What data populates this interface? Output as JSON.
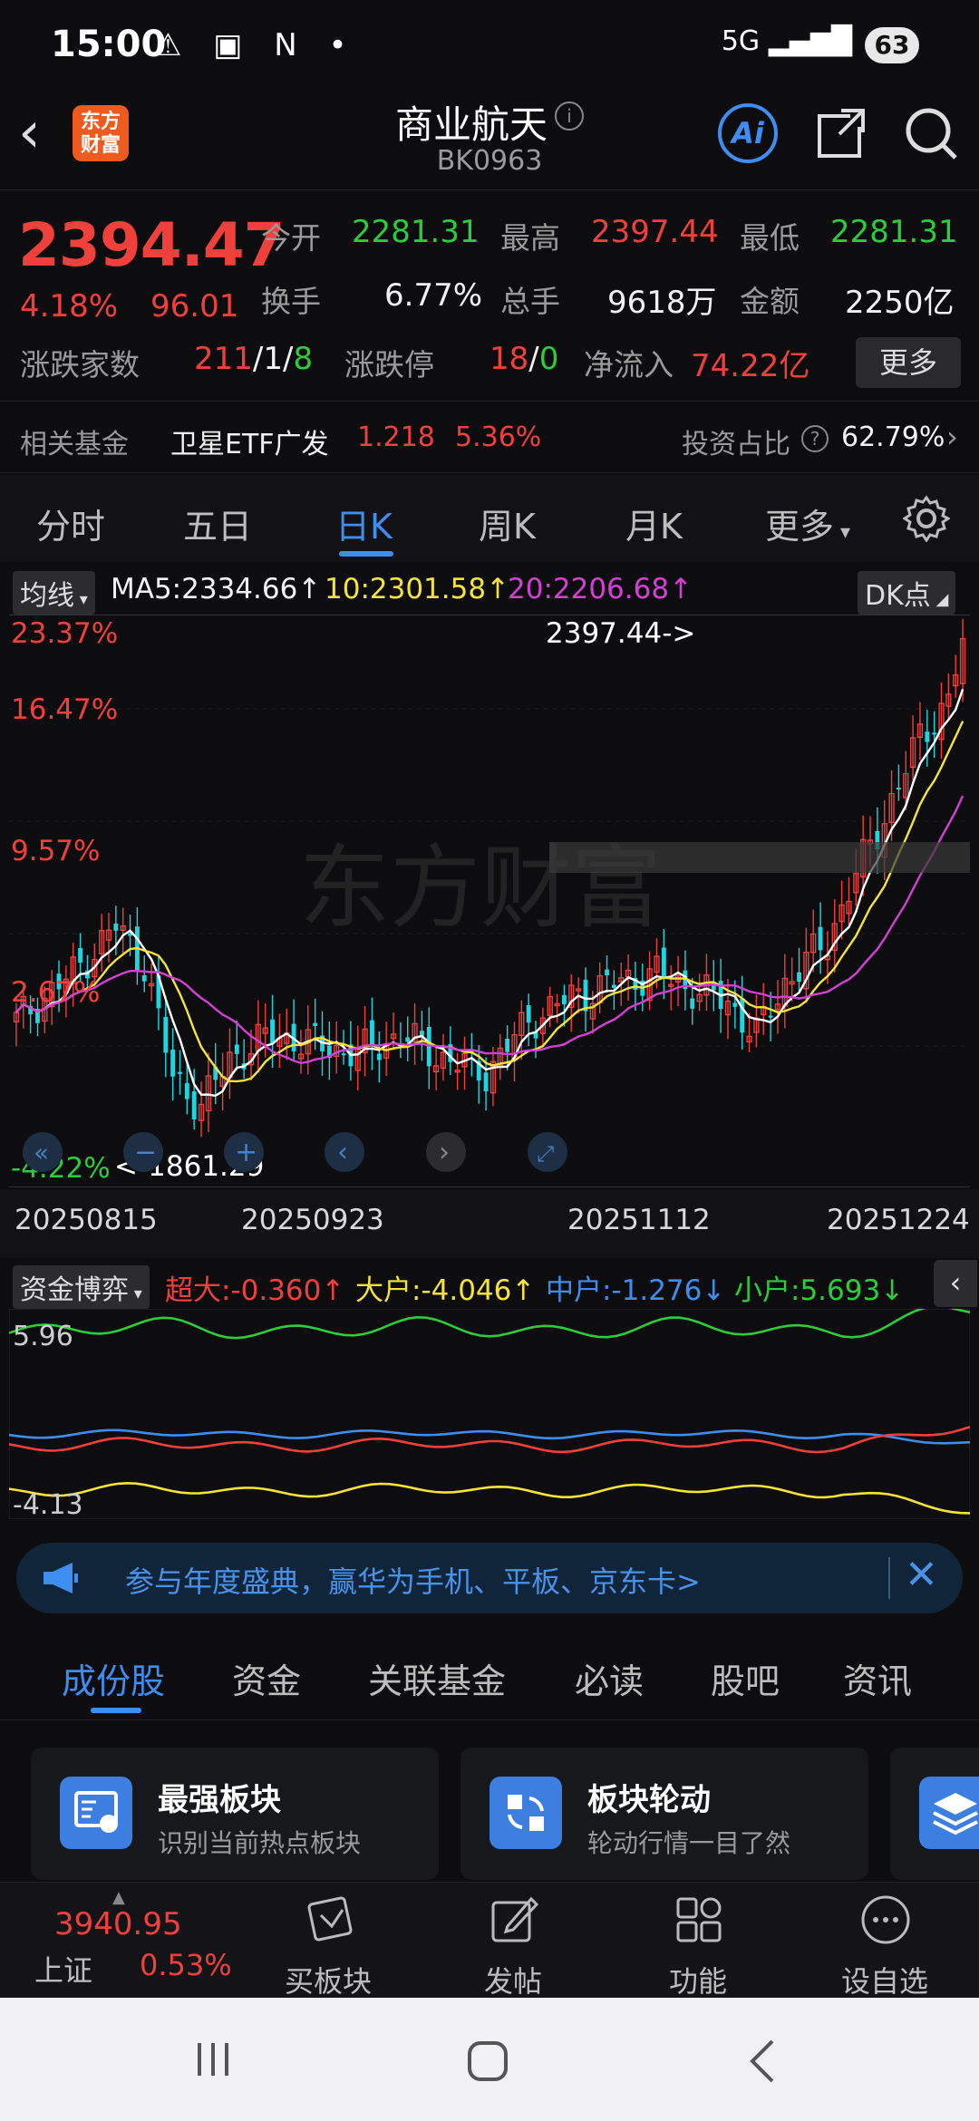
{
  "status": {
    "time": "15:00",
    "battery": "63",
    "signal": "5G"
  },
  "header": {
    "logo": "东方财富",
    "title": "商业航天",
    "code": "BK0963"
  },
  "quote": {
    "price": "2394.47",
    "pct": "4.18%",
    "change": "96.01",
    "rows": [
      [
        {
          "label": "今开",
          "value": "2281.31",
          "color": "green"
        },
        {
          "label": "最高",
          "value": "2397.44",
          "color": "red"
        },
        {
          "label": "最低",
          "value": "2281.31",
          "color": "green"
        }
      ],
      [
        {
          "label": "换手",
          "value": "6.77%",
          "color": "white"
        },
        {
          "label": "总手",
          "value": "9618万",
          "color": "white"
        },
        {
          "label": "金额",
          "value": "2250亿",
          "color": "white"
        }
      ]
    ],
    "breadth_label": "涨跌家数",
    "breadth_up": "211",
    "breadth_flat": "1",
    "breadth_down": "8",
    "limit_label": "涨跌停",
    "limit_up": "18",
    "limit_down": "0",
    "inflow_label": "净流入",
    "inflow": "74.22亿",
    "more": "更多"
  },
  "fund": {
    "label": "相关基金",
    "name": "卫星ETF广发",
    "price": "1.218",
    "pct": "5.36%",
    "ratio_label": "投资占比",
    "ratio": "62.79%"
  },
  "tabs": [
    "分时",
    "五日",
    "日K",
    "周K",
    "月K",
    "更多"
  ],
  "ma": {
    "selector": "均线",
    "ma5": "MA5:2334.66",
    "ma10": "10:2301.58",
    "ma20": "20:2206.68",
    "dk": "DK点"
  },
  "kchart": {
    "pct_labels": [
      "23.37%",
      "16.47%",
      "9.57%",
      "2.67%",
      "-4.22%"
    ],
    "high_marker": "2397.44->",
    "low_marker": "<-1861.29",
    "watermark": "东方财富"
  },
  "dates": [
    "20250815",
    "20250923",
    "20251112",
    "20251224"
  ],
  "flow": {
    "selector": "资金博弈",
    "super": "超大:-0.360",
    "big": "大户:-4.046",
    "mid": "中户:-1.276",
    "small": "小户:5.693",
    "top": "5.96",
    "bottom": "-4.13"
  },
  "banner": {
    "text": "参与年度盛典，赢华为手机、平板、京东卡>"
  },
  "subtabs": [
    "成份股",
    "资金",
    "关联基金",
    "必读",
    "股吧",
    "资讯"
  ],
  "cards": [
    {
      "title": "最强板块",
      "sub": "识别当前热点板块"
    },
    {
      "title": "板块轮动",
      "sub": "轮动行情一目了然"
    }
  ],
  "toolbar": {
    "index_price": "3940.95",
    "index_name": "上证",
    "index_pct": "0.53%",
    "items": [
      "买板块",
      "发帖",
      "功能",
      "设自选"
    ]
  },
  "chart_data": {
    "type": "candlestick",
    "x": [
      "20250815",
      "20250923",
      "20251112",
      "20251224"
    ],
    "high": 2397.44,
    "low": 1861.29,
    "ylim_pct": [
      -4.22,
      23.37
    ],
    "pct_ticks": [
      23.37,
      16.47,
      9.57,
      2.67,
      -4.22
    ],
    "ma": {
      "MA5": 2334.66,
      "MA10": 2301.58,
      "MA20": 2206.68
    },
    "colors": {
      "MA5": "#ffffff",
      "MA10": "#f5e33a",
      "MA20": "#d43fd6",
      "up": "#f0403c",
      "down": "#20d4e0"
    }
  }
}
